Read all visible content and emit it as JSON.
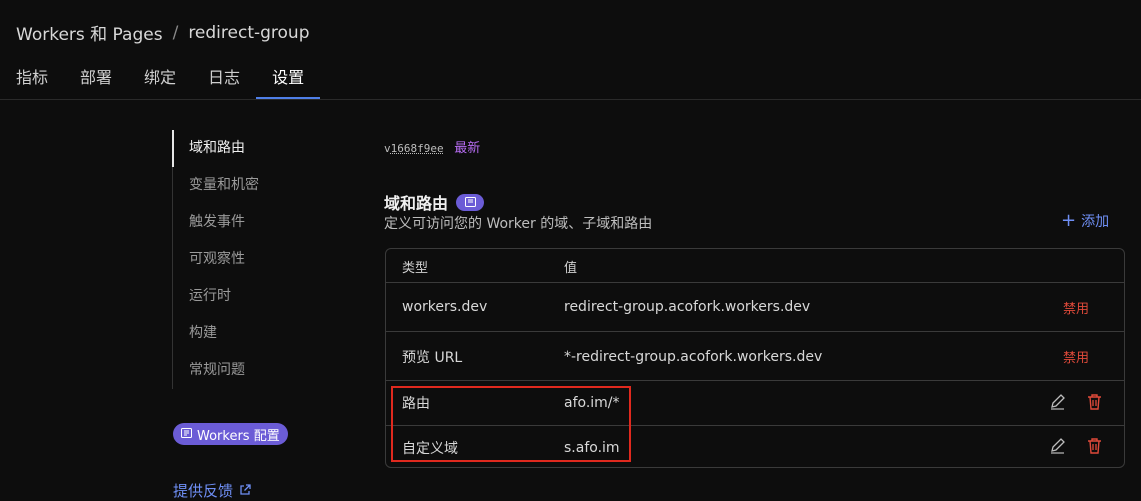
{
  "breadcrumb": {
    "root": "Workers 和 Pages",
    "separator": "/",
    "current": "redirect-group"
  },
  "tabs": [
    {
      "label": "指标"
    },
    {
      "label": "部署"
    },
    {
      "label": "绑定"
    },
    {
      "label": "日志"
    },
    {
      "label": "设置",
      "active": true
    }
  ],
  "sidenav": {
    "items": [
      {
        "label": "域和路由",
        "active": true
      },
      {
        "label": "变量和机密"
      },
      {
        "label": "触发事件"
      },
      {
        "label": "可观察性"
      },
      {
        "label": "运行时"
      },
      {
        "label": "构建"
      },
      {
        "label": "常规问题"
      }
    ],
    "config_badge": "Workers 配置",
    "feedback": "提供反馈"
  },
  "version": {
    "prefix": "v",
    "hash": "1668f9ee",
    "latest": "最新"
  },
  "section": {
    "title": "域和路由",
    "description": "定义可访问您的 Worker 的域、子域和路由",
    "add_label": "添加"
  },
  "table": {
    "headers": {
      "type": "类型",
      "value": "值"
    },
    "rows": [
      {
        "type": "workers.dev",
        "value": "redirect-group.acofork.workers.dev",
        "action": "禁用"
      },
      {
        "type": "预览 URL",
        "value": "*-redirect-group.acofork.workers.dev",
        "action": "禁用"
      },
      {
        "type": "路由",
        "value": "afo.im/*"
      },
      {
        "type": "自定义域",
        "value": "s.afo.im"
      }
    ]
  },
  "colors": {
    "accent": "#6f8ff5",
    "badge": "#6b5cd6",
    "danger": "#e04a3a",
    "highlight": "#e0291e",
    "latest": "#b56cf0"
  },
  "icons": [
    "doc-icon",
    "plus-icon",
    "external-link-icon",
    "edit-icon",
    "trash-icon"
  ]
}
